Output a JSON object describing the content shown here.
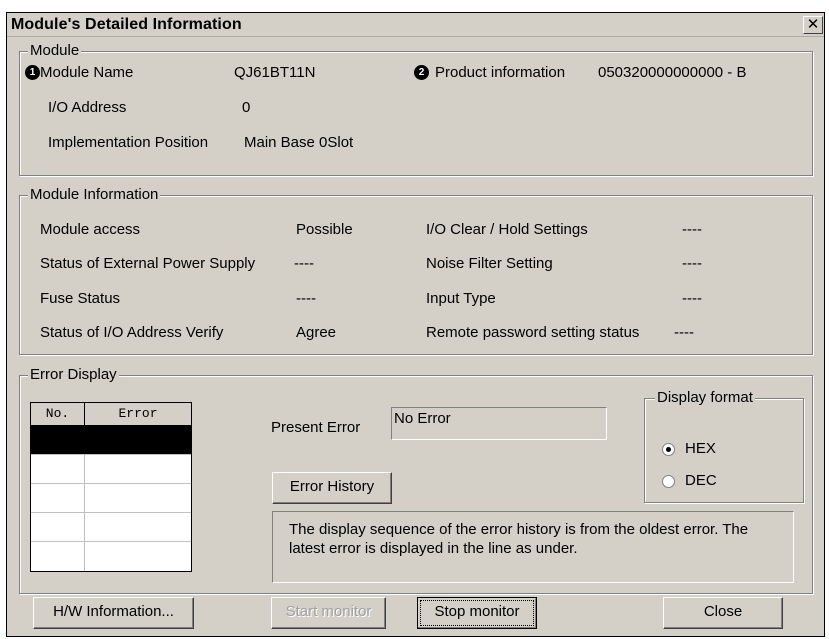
{
  "window": {
    "title": "Module's Detailed Information",
    "close_glyph": "✕"
  },
  "module": {
    "legend": "Module",
    "badge1": "1",
    "badge2": "2",
    "name_label": "Module Name",
    "name_value": "QJ61BT11N",
    "product_label": "Product information",
    "product_value": "050320000000000 - B",
    "io_label": "I/O Address",
    "io_value": "0",
    "impl_label": "Implementation Position",
    "impl_value": "Main Base  0Slot"
  },
  "module_info": {
    "legend": "Module Information",
    "rows": [
      {
        "label": "Module access",
        "value": "Possible",
        "label2": "I/O Clear / Hold Settings",
        "value2": "----"
      },
      {
        "label": "Status of External Power Supply",
        "value": "----",
        "label2": "Noise Filter Setting",
        "value2": "----"
      },
      {
        "label": "Fuse Status",
        "value": "----",
        "label2": "Input Type",
        "value2": "----"
      },
      {
        "label": "Status of I/O Address Verify",
        "value": "Agree",
        "label2": "Remote password setting status",
        "value2": "----"
      }
    ]
  },
  "error_display": {
    "legend": "Error Display",
    "col_no": "No.",
    "col_error": "Error",
    "present_label": "Present Error",
    "present_value": "No Error",
    "history_button": "Error History",
    "note": "The display sequence of the error history is from the oldest error. The latest error is displayed in the line as under.",
    "format": {
      "legend": "Display format",
      "options": [
        "HEX",
        "DEC"
      ],
      "selected": "HEX"
    }
  },
  "buttons": {
    "hw_info": "H/W Information...",
    "start_monitor": "Start monitor",
    "stop_monitor": "Stop monitor",
    "close": "Close"
  }
}
